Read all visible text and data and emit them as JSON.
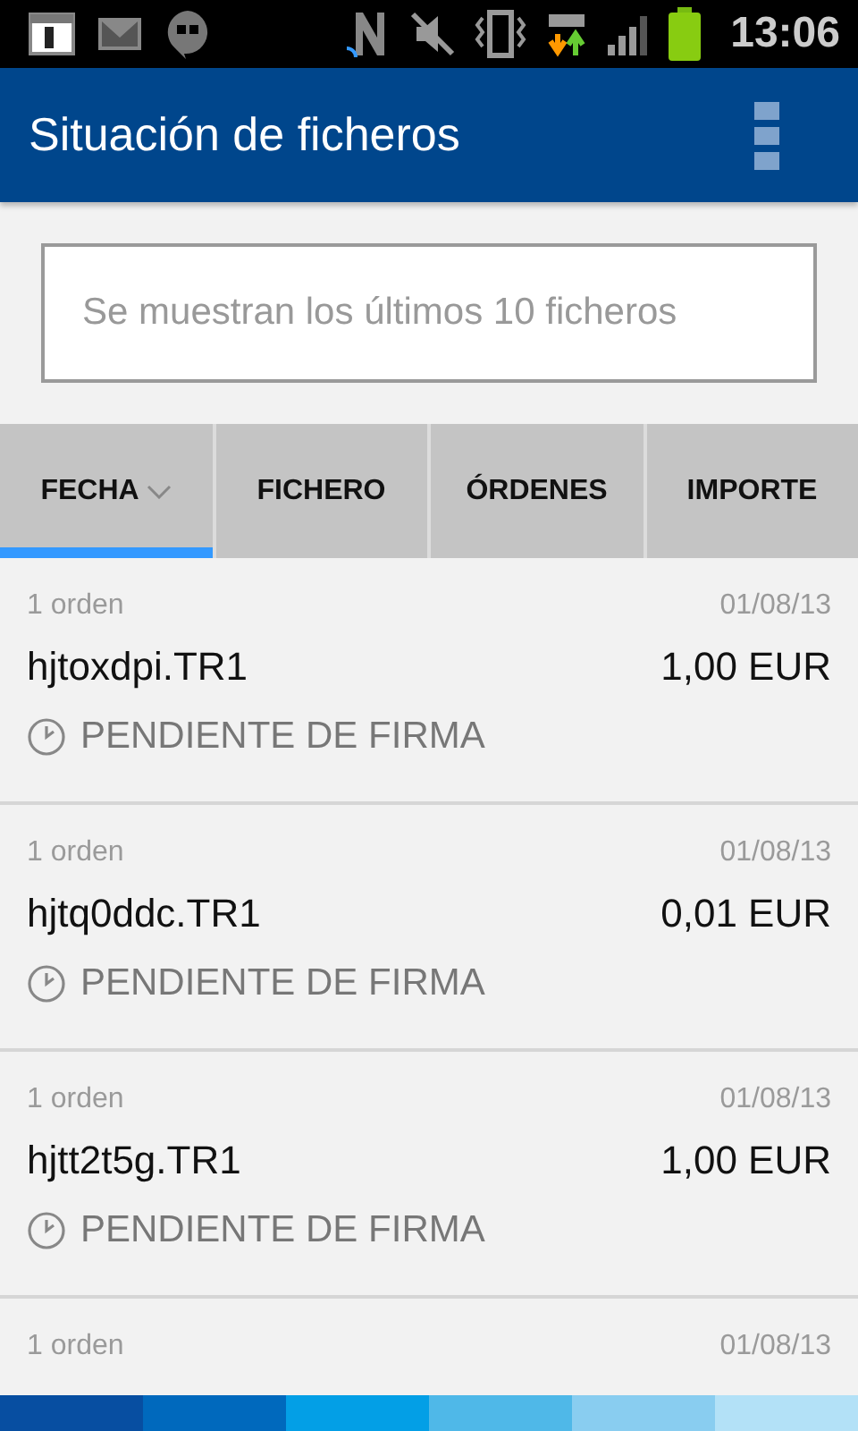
{
  "status_bar": {
    "time": "13:06"
  },
  "app_bar": {
    "title": "Situación de ficheros"
  },
  "notice": {
    "text": "Se muestran los últimos 10 ficheros"
  },
  "tabs": [
    {
      "label": "FECHA",
      "selected": true,
      "sorted": true
    },
    {
      "label": "FICHERO",
      "selected": false,
      "sorted": false
    },
    {
      "label": "ÓRDENES",
      "selected": false,
      "sorted": false
    },
    {
      "label": "IMPORTE",
      "selected": false,
      "sorted": false
    }
  ],
  "files": [
    {
      "orders": "1 orden",
      "date": "01/08/13",
      "name": "hjtoxdpi.TR1",
      "amount": "1,00 EUR",
      "status": "PENDIENTE DE FIRMA"
    },
    {
      "orders": "1 orden",
      "date": "01/08/13",
      "name": "hjtq0ddc.TR1",
      "amount": "0,01 EUR",
      "status": "PENDIENTE DE FIRMA"
    },
    {
      "orders": "1 orden",
      "date": "01/08/13",
      "name": "hjtt2t5g.TR1",
      "amount": "1,00 EUR",
      "status": "PENDIENTE DE FIRMA"
    },
    {
      "orders": "1 orden",
      "date": "01/08/13"
    }
  ]
}
